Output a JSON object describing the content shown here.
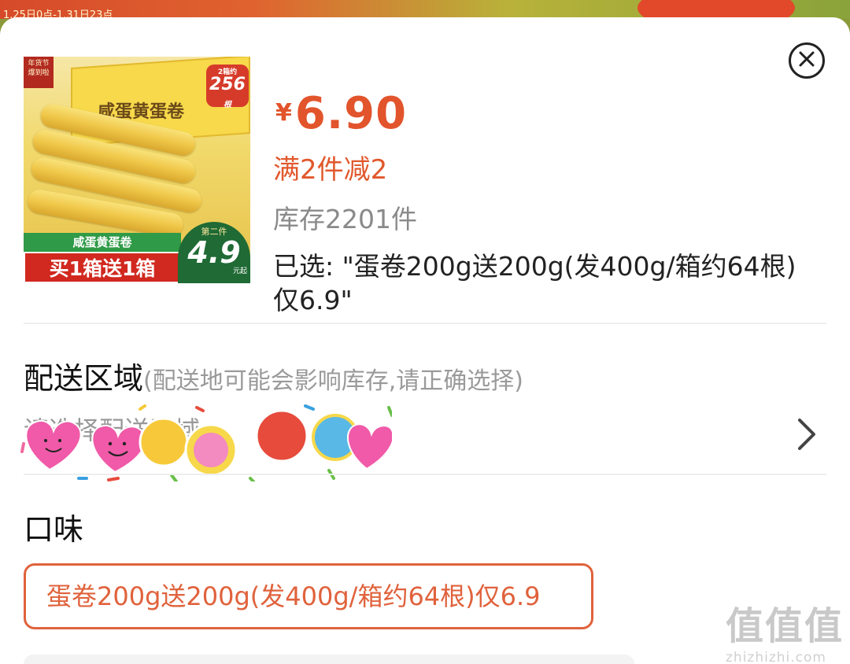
{
  "background": {
    "banner_text": "1.25日0点-1.31日23点",
    "colors": {
      "red": "#d64a2a",
      "green": "#8aa33a"
    }
  },
  "sheet": {
    "close_icon": "close-circle-icon",
    "product": {
      "image": {
        "tag": "年货节",
        "tag_sub": "爆到啦",
        "brand": "咸蛋黄蛋卷",
        "badge_top_small": "2箱约",
        "badge_top_number": "256",
        "badge_top_unit": "根",
        "caption_green": "咸蛋黄蛋卷",
        "caption_red": "买1箱送1箱",
        "price_label": "第二件",
        "price_number": "4.9",
        "price_unit": "元起"
      },
      "currency": "¥",
      "price": "6.90",
      "promotion": "满2件减2",
      "stock": "库存2201件",
      "selected": "已选: \"蛋卷200g送200g(发400g/箱约64根)仅6.9\""
    },
    "delivery": {
      "title": "配送区域",
      "hint": "(配送地可能会影响库存,请正确选择)",
      "value": "请选择配送区域",
      "chevron_icon": "chevron-right-icon"
    },
    "flavor": {
      "title": "口味",
      "options": [
        "蛋卷200g送200g(发400g/箱约64根)仅6.9"
      ],
      "selected_index": 0,
      "accent_color": "#e0623c"
    }
  },
  "watermark": {
    "text": "值值值",
    "url": "zhizhizhi.com"
  },
  "colors": {
    "price": "#e2542c",
    "stock": "#8a8a8a",
    "hint": "#9a9a9a"
  }
}
